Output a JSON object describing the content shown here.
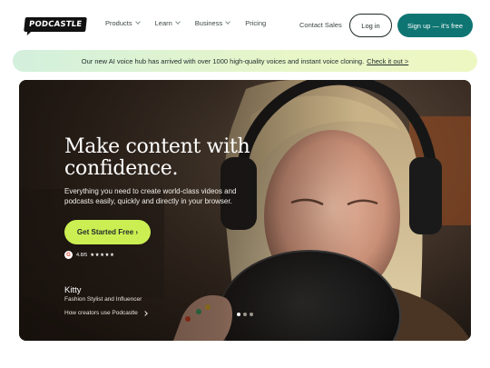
{
  "nav": {
    "logo_text": "PODCASTLE",
    "menu": [
      {
        "label": "Products",
        "has_dropdown": true
      },
      {
        "label": "Learn",
        "has_dropdown": true
      },
      {
        "label": "Business",
        "has_dropdown": true
      },
      {
        "label": "Pricing",
        "has_dropdown": false
      }
    ],
    "contact_label": "Contact Sales",
    "login_label": "Log in",
    "signup_label": "Sign up — it's free"
  },
  "banner": {
    "text": "Our new AI voice hub has arrived with over 1000 high-quality voices and instant voice cloning.",
    "link_text": "Check it out >"
  },
  "hero": {
    "headline": "Make content with confidence.",
    "subtext": "Everything you need to create world-class videos and podcasts easily, quickly and directly in your browser.",
    "cta_label": "Get Started Free ›",
    "rating": {
      "badge": "G",
      "score": "4.8/5",
      "stars": "★★★★★"
    },
    "person_name": "Kitty",
    "person_role": "Fashion Stylist and Influencer",
    "creators_link": "How creators use Podcastle",
    "carousel": {
      "count": 3,
      "active_index": 0
    }
  },
  "colors": {
    "brand_teal": "#0e7572",
    "cta_lime": "#cbef52",
    "banner_green": "#d3f0dd"
  }
}
